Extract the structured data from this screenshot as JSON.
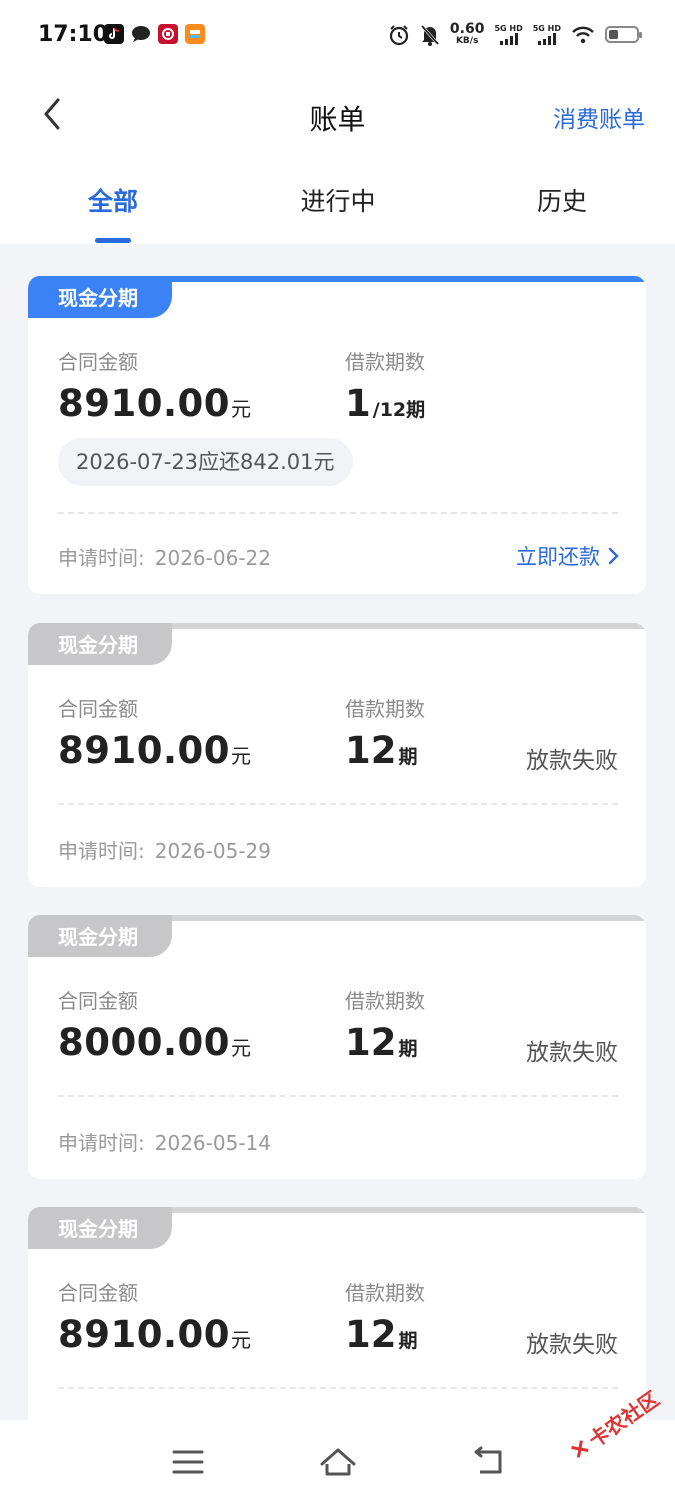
{
  "status_bar": {
    "time": "17:10",
    "speed_value": "0.60",
    "speed_unit": "KB/s",
    "signal1_label": "5G HD",
    "signal2_label": "5G HD",
    "battery_level": 0.35
  },
  "nav": {
    "title": "账单",
    "right_link": "消费账单"
  },
  "tabs": [
    {
      "label": "全部",
      "active": true
    },
    {
      "label": "进行中",
      "active": false
    },
    {
      "label": "历史",
      "active": false
    }
  ],
  "cards": [
    {
      "tag": "现金分期",
      "accent": "#3b82f6",
      "amount_label": "合同金额",
      "amount": "8910.00",
      "amount_unit": "元",
      "term_label": "借款期数",
      "term_value": "1",
      "term_suffix": "/12期",
      "due": "2026-07-23应还842.01元",
      "apply_label": "申请时间:",
      "apply_date": "2026-06-22",
      "action": "立即还款"
    },
    {
      "tag": "现金分期",
      "accent": "#c7c7c9",
      "amount_label": "合同金额",
      "amount": "8910.00",
      "amount_unit": "元",
      "term_label": "借款期数",
      "term_value": "12",
      "term_suffix": "期",
      "status": "放款失败",
      "apply_label": "申请时间:",
      "apply_date": "2026-05-29"
    },
    {
      "tag": "现金分期",
      "accent": "#c7c7c9",
      "amount_label": "合同金额",
      "amount": "8000.00",
      "amount_unit": "元",
      "term_label": "借款期数",
      "term_value": "12",
      "term_suffix": "期",
      "status": "放款失败",
      "apply_label": "申请时间:",
      "apply_date": "2026-05-14"
    },
    {
      "tag": "现金分期",
      "accent": "#c7c7c9",
      "amount_label": "合同金额",
      "amount": "8910.00",
      "amount_unit": "元",
      "term_label": "借款期数",
      "term_value": "12",
      "term_suffix": "期",
      "status": "放款失败"
    }
  ],
  "watermark": "卡农社区",
  "colors": {
    "primary": "#2a6adb",
    "tag_active": "#3b82f6",
    "tag_inactive": "#c7c7c9"
  }
}
